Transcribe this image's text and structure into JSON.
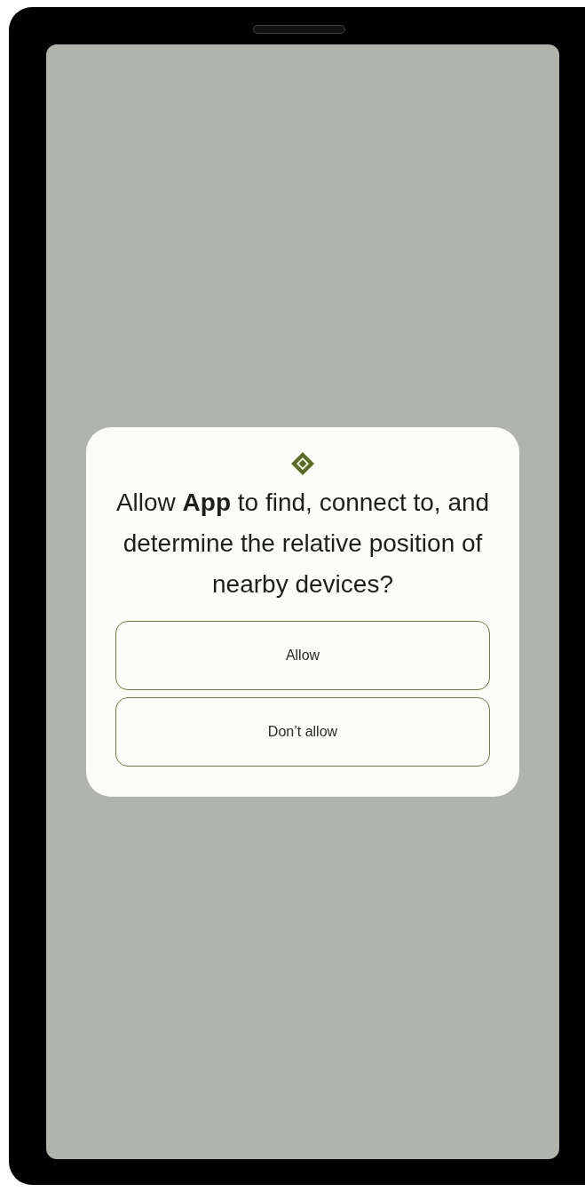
{
  "dialog": {
    "title": "Allow **App** to find, connect to, and determine the relative position of nearby devices?",
    "buttons": [
      {
        "label": "Allow"
      },
      {
        "label": "Don’t allow"
      }
    ]
  }
}
